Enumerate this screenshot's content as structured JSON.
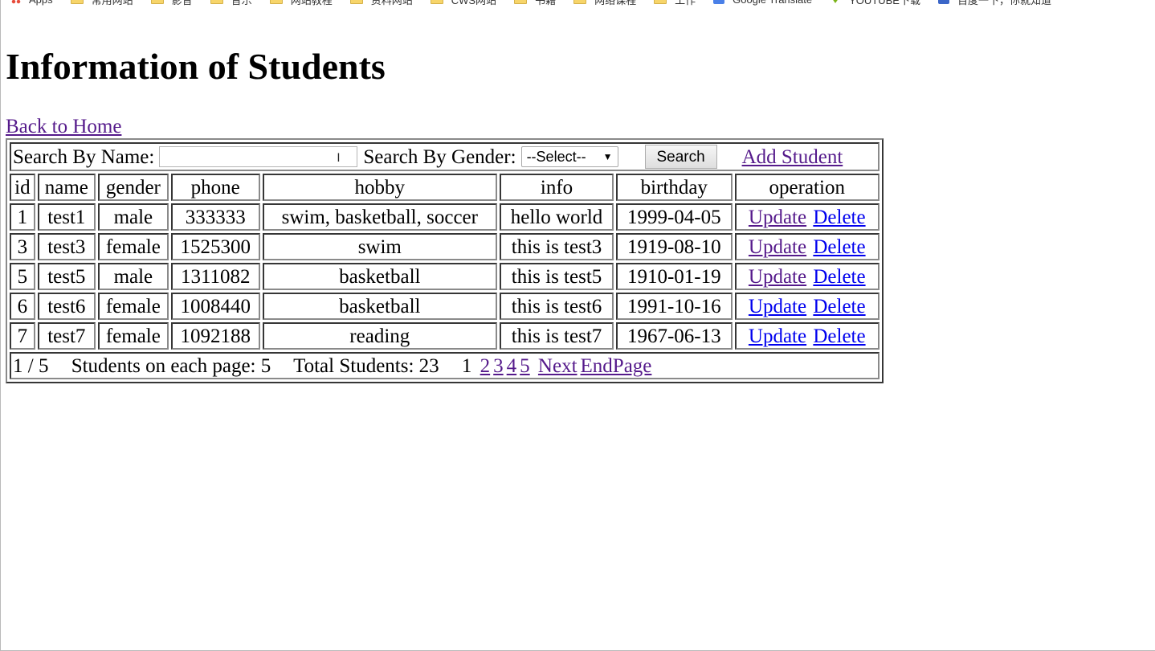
{
  "bookmarks": [
    {
      "label": "Apps",
      "icon": "apps-icon"
    },
    {
      "label": "常用网站",
      "icon": "folder-icon"
    },
    {
      "label": "影音",
      "icon": "folder-icon"
    },
    {
      "label": "音乐",
      "icon": "folder-icon"
    },
    {
      "label": "网站教程",
      "icon": "folder-icon"
    },
    {
      "label": "资料网站",
      "icon": "folder-icon"
    },
    {
      "label": "CWS网站",
      "icon": "folder-icon"
    },
    {
      "label": "书籍",
      "icon": "folder-icon"
    },
    {
      "label": "网络课程",
      "icon": "folder-icon"
    },
    {
      "label": "工作",
      "icon": "folder-icon"
    },
    {
      "label": "Google Translate",
      "icon": "translate-icon"
    },
    {
      "label": "YOUTUBE下载",
      "icon": "youtube-icon"
    },
    {
      "label": "百度一下，你就知道",
      "icon": "baidu-icon"
    }
  ],
  "page": {
    "title": "Information of Students",
    "back_link": "Back to Home"
  },
  "search": {
    "name_label": "Search By Name:",
    "name_value": "",
    "gender_label": "Search By Gender:",
    "gender_selected": "--Select--",
    "search_button": "Search",
    "add_student": "Add Student"
  },
  "table": {
    "headers": [
      "id",
      "name",
      "gender",
      "phone",
      "hobby",
      "info",
      "birthday",
      "operation"
    ],
    "rows": [
      {
        "id": "1",
        "name": "test1",
        "gender": "male",
        "phone": "333333",
        "hobby": "swim, basketball, soccer",
        "info": "hello world",
        "birthday": "1999-04-05"
      },
      {
        "id": "3",
        "name": "test3",
        "gender": "female",
        "phone": "1525300",
        "hobby": "swim",
        "info": "this is test3",
        "birthday": "1919-08-10"
      },
      {
        "id": "5",
        "name": "test5",
        "gender": "male",
        "phone": "1311082",
        "hobby": "basketball",
        "info": "this is test5",
        "birthday": "1910-01-19"
      },
      {
        "id": "6",
        "name": "test6",
        "gender": "female",
        "phone": "1008440",
        "hobby": "basketball",
        "info": "this is test6",
        "birthday": "1991-10-16"
      },
      {
        "id": "7",
        "name": "test7",
        "gender": "female",
        "phone": "1092188",
        "hobby": "reading",
        "info": "this is test7",
        "birthday": "1967-06-13"
      }
    ],
    "update_label": "Update",
    "delete_label": "Delete"
  },
  "pager": {
    "position": "1 / 5",
    "per_page": "Students on each page: 5",
    "total": "Total Students: 23",
    "current_page": "1",
    "pages": [
      "2",
      "3",
      "4",
      "5"
    ],
    "next": "Next",
    "end": "EndPage"
  },
  "colors": {
    "link": "#0000ee",
    "visited_link": "#551a8b"
  }
}
